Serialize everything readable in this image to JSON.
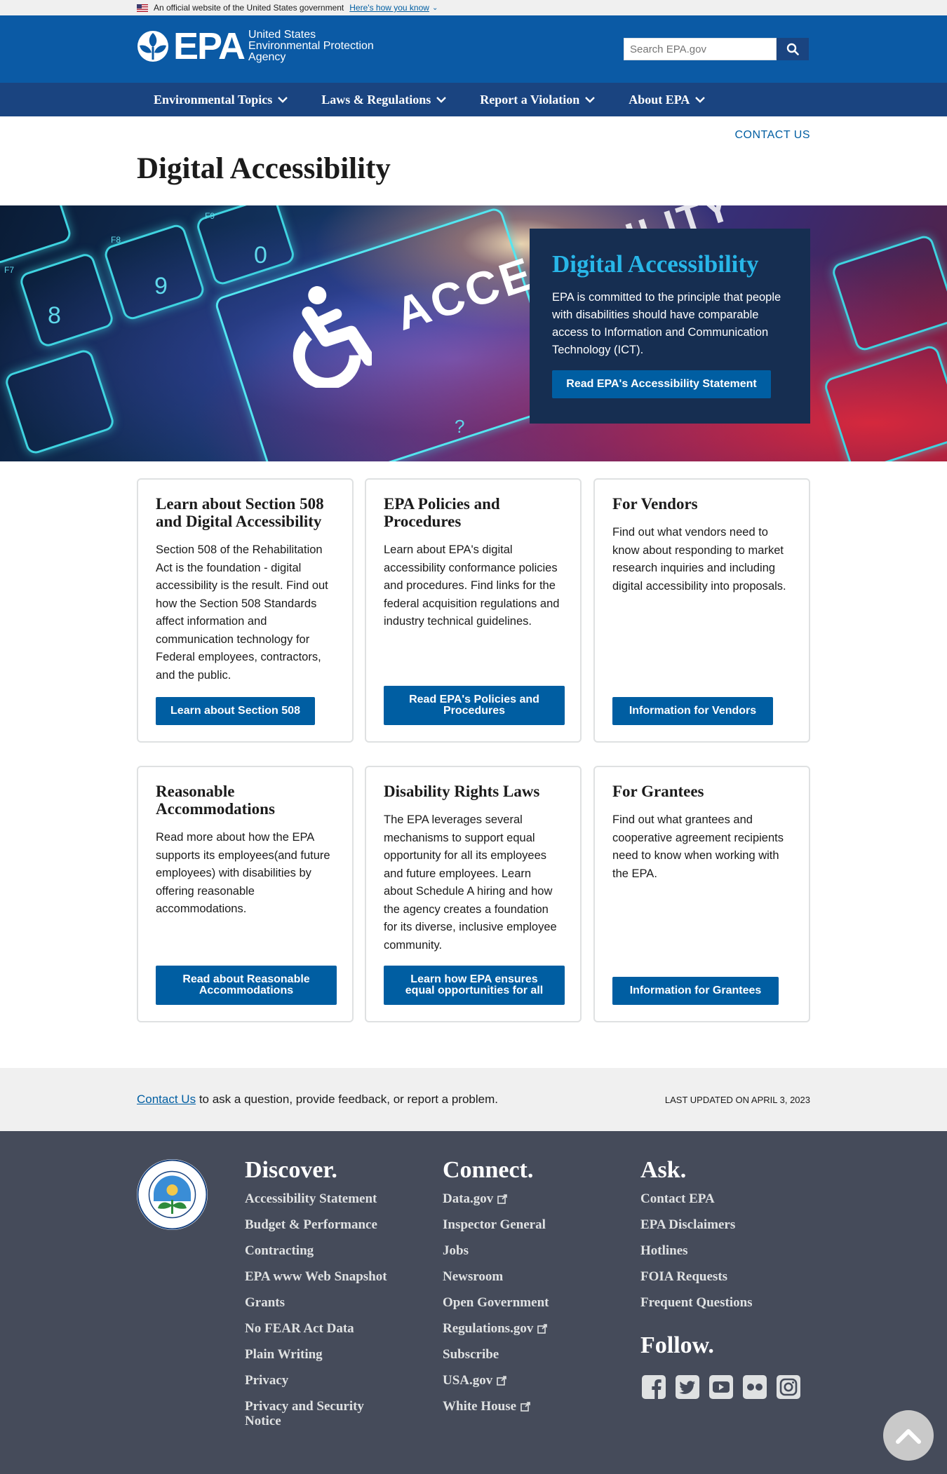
{
  "gov_banner": {
    "text": "An official website of the United States government",
    "link": "Here's how you know"
  },
  "header": {
    "logo_word": "EPA",
    "logo_line1": "United States",
    "logo_line2": "Environmental Protection",
    "logo_line3": "Agency",
    "search_placeholder": "Search EPA.gov"
  },
  "nav": {
    "items": [
      "Environmental Topics",
      "Laws & Regulations",
      "Report a Violation",
      "About EPA"
    ]
  },
  "page": {
    "contact_us": "CONTACT US",
    "title": "Digital Accessibility"
  },
  "hero": {
    "keycap_text": "ACCES",
    "keycap_text2": "ILITY",
    "key_labels": [
      "F7",
      "F8",
      "F9",
      "9",
      "8",
      "0",
      "?"
    ],
    "card_title": "Digital Accessibility",
    "card_body": "EPA is committed to the principle that people with disabilities should have comparable access to Information and Communication Technology (ICT).",
    "card_button": "Read EPA's Accessibility Statement"
  },
  "cards": [
    {
      "title": "Learn about Section 508 and Digital Accessibility",
      "body": "Section 508 of the Rehabilitation Act is the foundation - digital accessibility is the result. Find out how the Section 508 Standards affect information and communication technology for Federal employees, contractors, and the public.",
      "button": "Learn about Section 508"
    },
    {
      "title": "EPA Policies and Procedures",
      "body": "Learn about EPA's digital accessibility conformance policies and procedures. Find links for the federal acquisition regulations and industry technical guidelines.",
      "button": "Read EPA's Policies and Procedures"
    },
    {
      "title": "For Vendors",
      "body": "Find out what vendors need to know about responding to market research inquiries and including digital accessibility into  proposals.",
      "button": "Information for Vendors"
    },
    {
      "title": "Reasonable Accommodations",
      "body": "Read more about how the EPA supports its employees(and future employees) with disabilities by offering reasonable accommodations.",
      "button": "Read about Reasonable Accommodations"
    },
    {
      "title": "Disability Rights Laws",
      "body": "The EPA leverages several mechanisms to support equal opportunity for all its employees and future employees. Learn about Schedule A hiring and how the agency creates a foundation for its diverse, inclusive employee community.",
      "button": "Learn how EPA ensures equal opportunities for all"
    },
    {
      "title": "For Grantees",
      "body": "Find out what grantees and cooperative agreement recipients need to know when working with the EPA.",
      "button": "Information for Grantees"
    }
  ],
  "contact_bar": {
    "link": "Contact Us",
    "text": " to ask a question, provide feedback, or report a problem.",
    "last_updated": "LAST UPDATED ON APRIL 3, 2023"
  },
  "footer": {
    "discover": {
      "title": "Discover.",
      "links": [
        "Accessibility Statement",
        "Budget & Performance",
        "Contracting",
        "EPA www Web Snapshot",
        "Grants",
        "No FEAR Act Data",
        "Plain Writing",
        "Privacy",
        "Privacy and Security Notice"
      ]
    },
    "connect": {
      "title": "Connect.",
      "links": [
        "Data.gov",
        "Inspector General",
        "Jobs",
        "Newsroom",
        "Open Government",
        "Regulations.gov",
        "Subscribe",
        "USA.gov",
        "White House"
      ],
      "external": [
        true,
        false,
        false,
        false,
        false,
        true,
        false,
        true,
        true
      ]
    },
    "ask": {
      "title": "Ask.",
      "links": [
        "Contact EPA",
        "EPA Disclaimers",
        "Hotlines",
        "FOIA Requests",
        "Frequent Questions"
      ]
    },
    "follow_title": "Follow.",
    "social": [
      "facebook-icon",
      "twitter-icon",
      "youtube-icon",
      "flickr-icon",
      "instagram-icon"
    ]
  },
  "colors": {
    "header_blue": "#0b5aa5",
    "nav_blue": "#1a4480",
    "button_blue": "#005ea2",
    "hero_title": "#28b6e8",
    "footer_bg": "#454b5a"
  }
}
